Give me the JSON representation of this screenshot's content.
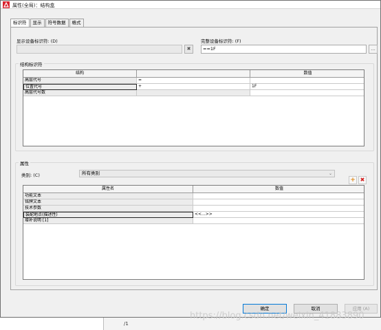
{
  "window": {
    "title": "属性(全局)：结构盒"
  },
  "tabs": [
    {
      "label": "标识符"
    },
    {
      "label": "显示"
    },
    {
      "label": "符号数据"
    },
    {
      "label": "格式"
    }
  ],
  "identifier": {
    "display_label": "显示设备标识符: (D)",
    "display_value": "",
    "clear_symbol": "✖",
    "full_label": "完整设备标识符: (F)",
    "full_value": "==1F",
    "browse_label": "..."
  },
  "structure_group": {
    "title": "结构标识符",
    "columns": [
      "结构",
      "",
      "数值"
    ],
    "rows": [
      {
        "name": "高层代号",
        "prefix": "=",
        "value": ""
      },
      {
        "name": "位置代号",
        "prefix": "+",
        "value": "1F"
      },
      {
        "name": "高层代号数",
        "prefix": "",
        "value": ""
      }
    ]
  },
  "properties_group": {
    "title": "属性",
    "category_label": "类别: (C)",
    "category_value": "所有类别",
    "add_symbol": "+",
    "delete_symbol": "✖",
    "columns": [
      "属性名",
      "数值"
    ],
    "rows": [
      {
        "name": "功能文本",
        "value": ""
      },
      {
        "name": "铭牌文本",
        "value": ""
      },
      {
        "name": "技术参数",
        "value": ""
      },
      {
        "name": "装配地点(描述性)",
        "value": "<<...>>"
      },
      {
        "name": "增补说明 [1]",
        "value": ""
      }
    ]
  },
  "buttons": {
    "ok": "确定",
    "cancel": "取消",
    "apply": "应用 (A)"
  },
  "background_app": {
    "text": "/1"
  },
  "watermark": "https://blog.csdn.net/weixin_41883890",
  "colors": {
    "accent": "#0078d7",
    "app_icon": "#d9232e",
    "delete": "#d42020",
    "add": "#e08a1a"
  }
}
